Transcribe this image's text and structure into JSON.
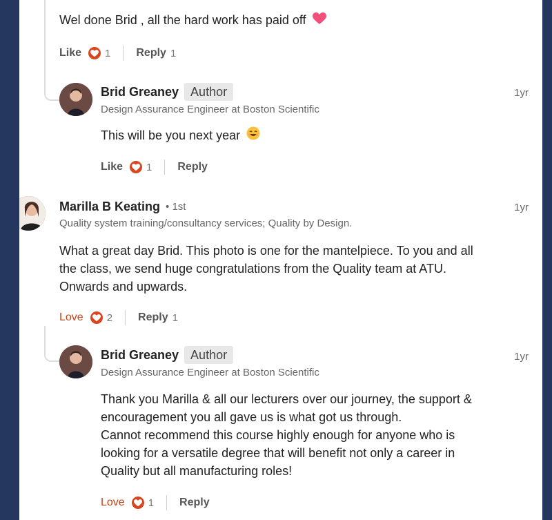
{
  "comment0": {
    "text": "Wel done Brid , all the hard work has paid off",
    "emoji": "heart-emoji",
    "like_label": "Like",
    "like_count": "1",
    "reply_label": "Reply",
    "reply_count": "1"
  },
  "reply1": {
    "name": "Brid Greaney",
    "badge": "Author",
    "headline": "Design Assurance Engineer at Boston Scientific",
    "time": "1yr",
    "text": "This will be you next year",
    "emoji": "grinning-face-emoji",
    "like_label": "Like",
    "like_count": "1",
    "reply_label": "Reply"
  },
  "comment2": {
    "name": "Marilla B Keating",
    "degree": "• 1st",
    "headline": "Quality system training/consultancy services; Quality by Design.",
    "time": "1yr",
    "lines": [
      "What a great day Brid. This photo is one for the mantelpiece. To you and all",
      "the class, we send huge congratulations from the Quality team at ATU.",
      "Onwards and upwards."
    ],
    "love_label": "Love",
    "love_count": "2",
    "reply_label": "Reply",
    "reply_count": "1"
  },
  "reply3": {
    "name": "Brid Greaney",
    "badge": "Author",
    "headline": "Design Assurance Engineer at Boston Scientific",
    "time": "1yr",
    "lines": [
      "Thank you Marilla & all our lecturers over our journey, the support &",
      "encouragement you all gave us is what got us through.",
      "Cannot recommend this course highly enough for anyone who is",
      "looking for a versatile degree that will benefit not only a career in",
      "Quality but all manufacturing roles!"
    ],
    "love_label": "Love",
    "love_count": "1",
    "reply_label": "Reply"
  },
  "colors": {
    "frame": "#26375f",
    "reaction": "#d8451f",
    "love_text": "#c4421c",
    "heart_emoji": "#f0507a"
  },
  "icons": {
    "reaction": "heart-reaction-icon"
  }
}
